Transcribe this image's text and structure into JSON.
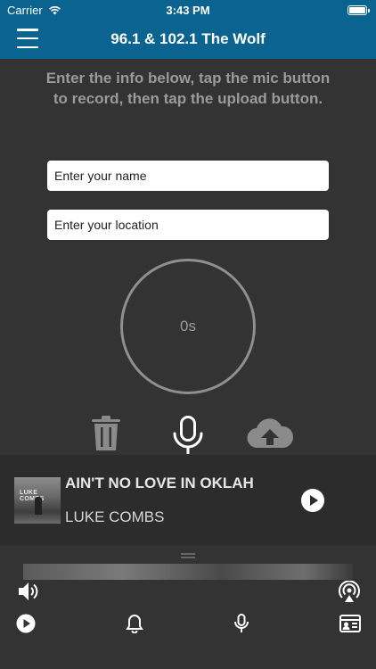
{
  "status_bar": {
    "carrier": "Carrier",
    "time": "3:43 PM"
  },
  "nav": {
    "title": "96.1 & 102.1 The Wolf"
  },
  "main": {
    "instructions": "Enter the info below, tap the mic button to record, then tap the upload button.",
    "name_placeholder": "Enter your name",
    "location_placeholder": "Enter your location",
    "record_time": "0s"
  },
  "now_playing": {
    "title": "AIN'T NO LOVE IN OKLAH",
    "artist": "LUKE COMBS",
    "album_art_text": "LUKE COMBS"
  },
  "icons": {
    "menu": "hamburger-icon",
    "trash": "trash-icon",
    "mic": "microphone-icon",
    "upload": "cloud-upload-icon",
    "volume": "speaker-icon",
    "airplay": "airplay-icon",
    "play": "play-icon",
    "alerts": "bell-icon",
    "contact": "contact-card-icon"
  },
  "colors": {
    "header": "#0b6390",
    "background": "#333333",
    "now_playing_bg": "#2c2c2c",
    "muted_text": "#9a9a9a"
  }
}
